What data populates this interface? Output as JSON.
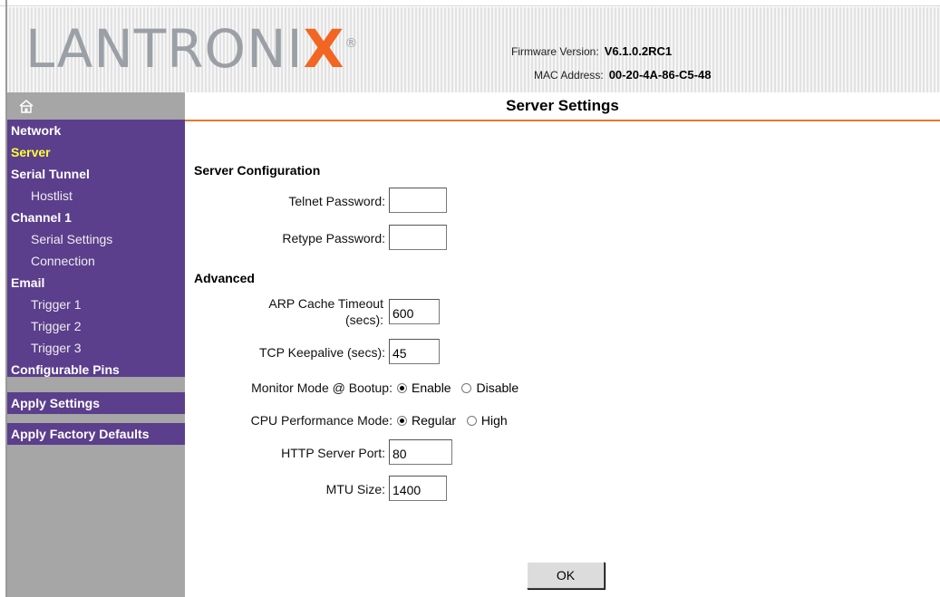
{
  "header": {
    "logo": {
      "prefix": "LANTRONI",
      "x": "X",
      "reg": "®"
    },
    "firmware_label": "Firmware Version:",
    "firmware_value": "V6.1.0.2RC1",
    "mac_label": "MAC Address:",
    "mac_value": "00-20-4A-86-C5-48",
    "accent_color": "#f26522"
  },
  "sidebar": {
    "home_icon": "home-icon",
    "items": [
      {
        "label": "Network",
        "level": "top",
        "active": false
      },
      {
        "label": "Server",
        "level": "top",
        "active": true
      },
      {
        "label": "Serial Tunnel",
        "level": "top",
        "active": false
      },
      {
        "label": "Hostlist",
        "level": "sub",
        "active": false
      },
      {
        "label": "Channel 1",
        "level": "top",
        "active": false
      },
      {
        "label": "Serial Settings",
        "level": "sub",
        "active": false
      },
      {
        "label": "Connection",
        "level": "sub",
        "active": false
      },
      {
        "label": "Email",
        "level": "top",
        "active": false
      },
      {
        "label": "Trigger 1",
        "level": "sub",
        "active": false
      },
      {
        "label": "Trigger 2",
        "level": "sub",
        "active": false
      },
      {
        "label": "Trigger 3",
        "level": "sub",
        "active": false
      },
      {
        "label": "Configurable Pins",
        "level": "top",
        "active": false
      },
      {
        "label": "Apply Settings",
        "level": "top",
        "active": false
      },
      {
        "label": "Apply Factory Defaults",
        "level": "top",
        "active": false
      }
    ],
    "menu_color": "#5b3e8c",
    "active_color": "#ffff33"
  },
  "main": {
    "title": "Server Settings",
    "server_config": {
      "heading": "Server Configuration",
      "telnet_password_label": "Telnet Password:",
      "telnet_password_value": "",
      "retype_password_label": "Retype Password:",
      "retype_password_value": ""
    },
    "advanced": {
      "heading": "Advanced",
      "arp_label_line1": "ARP Cache Timeout",
      "arp_label_line2": "(secs):",
      "arp_value": "600",
      "tcp_label": "TCP Keepalive (secs):",
      "tcp_value": "45",
      "monitor_label": "Monitor Mode @ Bootup:",
      "monitor_options": [
        "Enable",
        "Disable"
      ],
      "monitor_selected": "Enable",
      "cpu_label": "CPU Performance Mode:",
      "cpu_options": [
        "Regular",
        "High"
      ],
      "cpu_selected": "Regular",
      "http_label": "HTTP Server Port:",
      "http_value": "80",
      "mtu_label": "MTU Size:",
      "mtu_value": "1400"
    },
    "ok_label": "OK",
    "title_underline_color": "#e07a2f"
  }
}
